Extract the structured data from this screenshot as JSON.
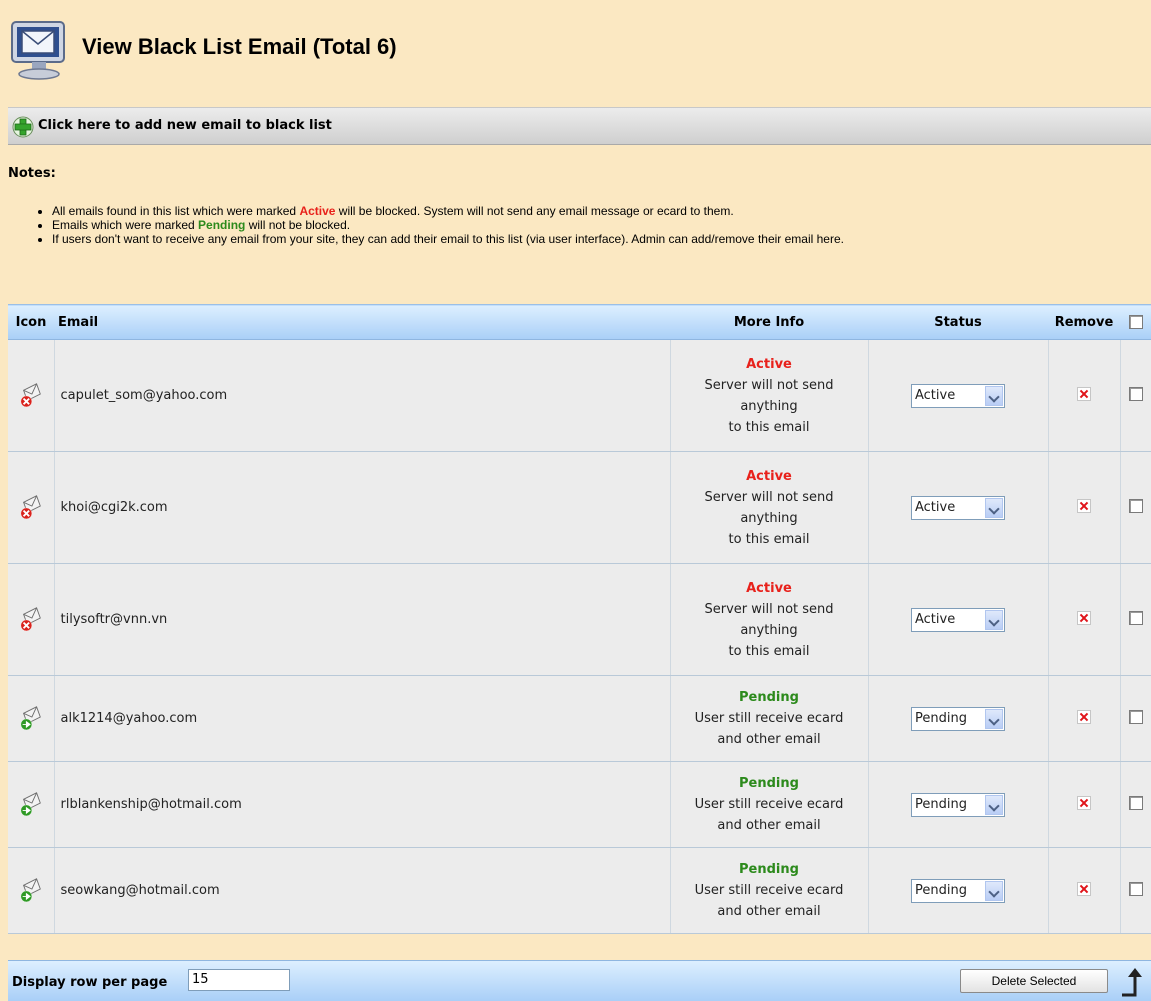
{
  "header": {
    "title": "View Black List Email (Total 6)",
    "icon": "monitor-email-icon"
  },
  "add_bar": {
    "label": "Click here to add new email to black list",
    "icon": "green-plus-icon"
  },
  "notes": {
    "title": "Notes:",
    "items": [
      {
        "before": "All emails found in this list which were marked ",
        "keyword": "Active",
        "after": " will be blocked. System will not send any email message or ecard to them."
      },
      {
        "before": "Emails which were marked ",
        "keyword": "Pending",
        "after": " will not be blocked."
      },
      {
        "before": "If users don't want to receive any email from your site, they can add their email to this list (via user interface). Admin can add/remove their email here.",
        "keyword": "",
        "after": ""
      }
    ]
  },
  "table": {
    "columns": [
      "Icon",
      "Email",
      "More Info",
      "Status",
      "Remove"
    ],
    "rows": [
      {
        "email": "capulet_som@yahoo.com",
        "status": "Active",
        "info_status": "Active",
        "info_lines": [
          "Server will not send",
          "anything",
          "to this email"
        ],
        "selected": "Active"
      },
      {
        "email": "khoi@cgi2k.com",
        "status": "Active",
        "info_status": "Active",
        "info_lines": [
          "Server will not send",
          "anything",
          "to this email"
        ],
        "selected": "Active"
      },
      {
        "email": "tilysoftr@vnn.vn",
        "status": "Active",
        "info_status": "Active",
        "info_lines": [
          "Server will not send",
          "anything",
          "to this email"
        ],
        "selected": "Active"
      },
      {
        "email": "alk1214@yahoo.com",
        "status": "Pending",
        "info_status": "Pending",
        "info_lines": [
          "User still receive ecard",
          "and other email"
        ],
        "selected": "Pending"
      },
      {
        "email": "rlblankenship@hotmail.com",
        "status": "Pending",
        "info_status": "Pending",
        "info_lines": [
          "User still receive ecard",
          "and other email"
        ],
        "selected": "Pending"
      },
      {
        "email": "seowkang@hotmail.com",
        "status": "Pending",
        "info_status": "Pending",
        "info_lines": [
          "User still receive ecard",
          "and other email"
        ],
        "selected": "Pending"
      }
    ]
  },
  "footer": {
    "rows_label": "Display row per page",
    "rows_value": "15",
    "delete_label": "Delete Selected"
  },
  "colors": {
    "background": "#fbe8c2",
    "active": "#e8211b",
    "pending": "#2c8a1c",
    "table_header": "#a9cff7"
  }
}
